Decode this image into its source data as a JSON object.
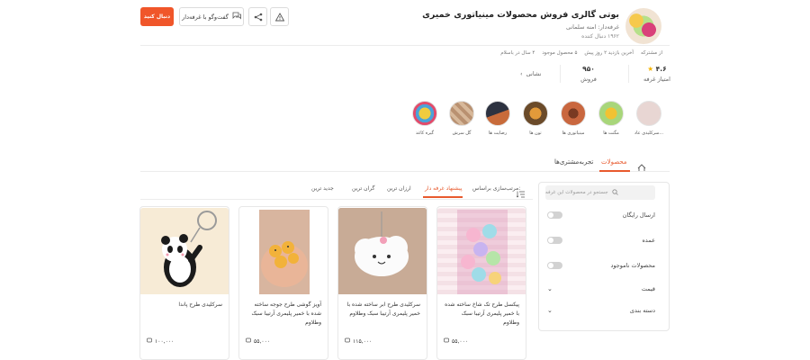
{
  "header": {
    "follow_label": "دنبال کنید",
    "chat_label": "گفت‌وگو با غرفه‌دار",
    "shop_title": "بوتی گالری فروش محصولات مینیاتوری خمیری",
    "owner": "غرفه‌دار: امنه سلمانی",
    "visits": "۱۹۶۲ دنبال کننده",
    "meta": [
      "از مشترکه",
      "آخرین بازدید ۲ روز پیش",
      "۵ محصول موجود",
      "۴ سال در باسلام"
    ]
  },
  "stats": {
    "rating_value": "۴.۶",
    "rating_label": "امتیاز غرفه",
    "sales_value": "۹۵۰",
    "sales_label": "فروش",
    "address_label": "نشانی"
  },
  "categories": [
    {
      "label": "سرکلیدی عاد...",
      "color": "#e8d6d3"
    },
    {
      "label": "مگنت ها",
      "color": "#d7e9b7"
    },
    {
      "label": "مینیاتوری ها",
      "color": "#c9673f"
    },
    {
      "label": "تون ها",
      "color": "#c8852f"
    },
    {
      "label": "رضایت ها",
      "color": "#4a4f5e"
    },
    {
      "label": "گل سرش",
      "color": "#caa98a"
    },
    {
      "label": "گیره کاغذ",
      "color": "#f0cc3f"
    }
  ],
  "tabs": [
    "محصولات",
    "تجربه‌مشتری‌ها"
  ],
  "sidebar": {
    "search_placeholder": "جستجو در محصولات این غرفه",
    "toggles": [
      "ارسال رایگان",
      "عمده",
      "محصولات ناموجود"
    ],
    "expanders": [
      "قیمت",
      "دسته بندی"
    ]
  },
  "sort": {
    "label": "مرتب‌سازی براساس:",
    "options": [
      "پیشنهاد غرفه دار",
      "ارزان ترین",
      "گران ترین",
      "جدید ترین"
    ]
  },
  "products": [
    {
      "name": "پیکسل طرح تک شاخ ساخته شده با خمیر پلیمری آرتیبا سبک وطلاوم",
      "price": "۵۵,۰۰۰"
    },
    {
      "name": "سرکلیدی طرح ابر ساخته شده با خمیر پلیمری آرتیبا سبک وطلاوم",
      "price": "۱۱۵,۰۰۰"
    },
    {
      "name": "آویز گوشی طرح جوجه ساخته شده با خمیر پلیمری آرتیبا سبک وطلاوم",
      "price": "۵۵,۰۰۰"
    },
    {
      "name": "سرکلیدی طرح پاندا",
      "price": "۱۰۰,۰۰۰"
    }
  ]
}
